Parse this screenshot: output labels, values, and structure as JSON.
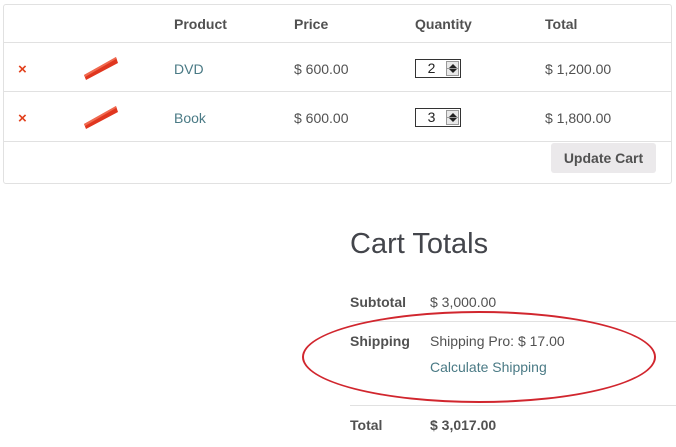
{
  "cart": {
    "headers": {
      "product": "Product",
      "price": "Price",
      "quantity": "Quantity",
      "total": "Total"
    },
    "items": [
      {
        "remove": "×",
        "name": "DVD",
        "price": "$ 600.00",
        "quantity": "2",
        "total": "$ 1,200.00"
      },
      {
        "remove": "×",
        "name": "Book",
        "price": "$ 600.00",
        "quantity": "3",
        "total": "$ 1,800.00"
      }
    ],
    "update_label": "Update Cart"
  },
  "totals": {
    "title": "Cart Totals",
    "subtotal_label": "Subtotal",
    "subtotal_value": "$ 3,000.00",
    "shipping_label": "Shipping",
    "shipping_value": "Shipping Pro: $ 17.00",
    "calculate_label": "Calculate Shipping",
    "total_label": "Total",
    "total_value": "$ 3,017.00"
  },
  "colors": {
    "accent_link": "#4a7a85",
    "remove": "#e2401c",
    "highlight": "#d1262e"
  }
}
